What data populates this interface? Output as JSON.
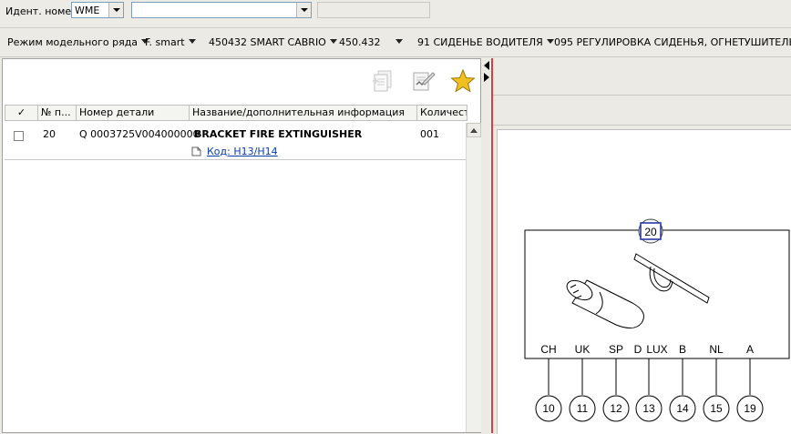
{
  "header": {
    "ident_label": "Идент. номер",
    "ident_type_value": "WME",
    "ident_number_value": "",
    "ident_readonly_value": ""
  },
  "breadcrumb": [
    {
      "label": "Режим модельного ряда"
    },
    {
      "label": "F. smart"
    },
    {
      "label": "450432 SMART CABRIO"
    },
    {
      "label": "450.432"
    },
    {
      "label": "91 СИДЕНЬЕ ВОДИТЕЛЯ"
    },
    {
      "label": "095 РЕГУЛИРОВКА СИДЕНЬЯ, ОГНЕТУШИТЕЛЬ"
    }
  ],
  "toolbar": {
    "icons": [
      "copy-list-icon",
      "edit-notes-icon",
      "favorite-star-icon"
    ]
  },
  "table": {
    "columns": [
      "✓",
      "№ п...",
      "Номер детали",
      "Название/дополнительная информация",
      "Количест"
    ],
    "rows": [
      {
        "pos": "20",
        "part_number": "Q 0003725V004000000",
        "name": "BRACKET FIRE EXTINGUISHER",
        "code": "Код: H13/H14",
        "qty": "001"
      }
    ]
  },
  "drawing": {
    "callout": "20",
    "variants": [
      "CH",
      "UK",
      "SP",
      "D",
      "LUX",
      "B",
      "NL",
      "A"
    ],
    "balloons": [
      "10",
      "11",
      "12",
      "13",
      "14",
      "15",
      "19"
    ]
  },
  "colors": {
    "background": "#ebeae4",
    "link": "#0b3cb0",
    "accent_border": "#d84040",
    "callout_border": "#1a2fa0",
    "star": "#f0c020"
  }
}
